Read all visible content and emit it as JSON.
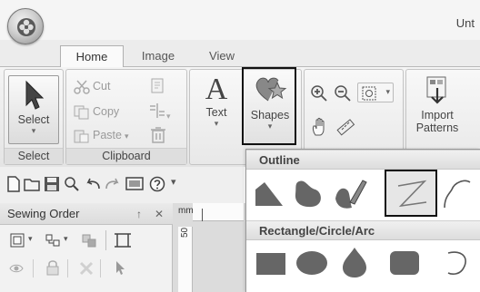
{
  "window": {
    "title": "Unt"
  },
  "tabs": [
    {
      "label": "Home"
    },
    {
      "label": "Image"
    },
    {
      "label": "View"
    }
  ],
  "ribbon": {
    "select_label": "Select",
    "clipboard": {
      "cut": "Cut",
      "copy": "Copy",
      "paste": "Paste"
    },
    "text_label": "Text",
    "text_glyph": "A",
    "shapes_label": "Shapes",
    "import_label_1": "Import",
    "import_label_2": "Patterns",
    "groups": {
      "select": "Select",
      "clipboard": "Clipboard"
    }
  },
  "sewing_order": {
    "title": "Sewing Order",
    "pin": "↑",
    "close": "✕"
  },
  "ruler": {
    "unit": "mm",
    "vlabel": "50"
  },
  "gallery": {
    "outline_heading": "Outline",
    "rectangle_heading": "Rectangle/Circle/Arc",
    "outline_items": [
      "polygon-shape",
      "blob-shape",
      "freehand-brush-shape",
      "zigzag-line-shape",
      "curve-line-shape"
    ],
    "rectangle_items": [
      "rectangle-shape",
      "ellipse-shape",
      "droplet-shape",
      "rounded-rectangle-shape",
      "arc-shape"
    ]
  },
  "colors": {
    "highlight_outline": "#111111",
    "shape_fill": "#666666",
    "ribbon_bg": "#e8e8e8"
  }
}
